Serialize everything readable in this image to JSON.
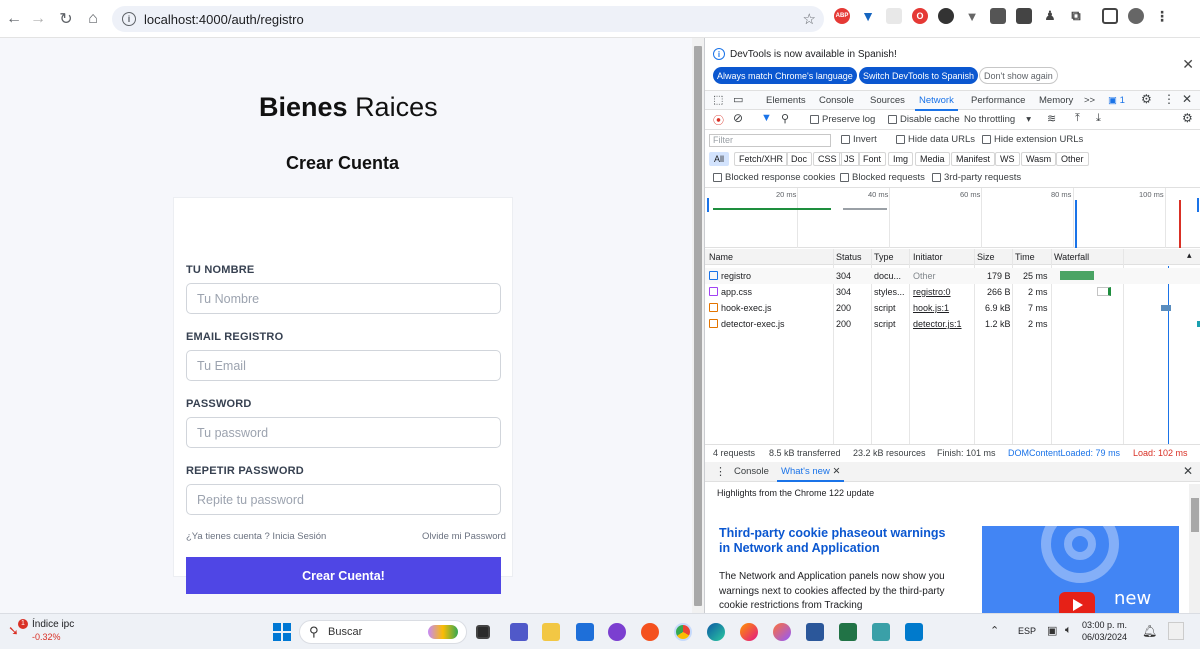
{
  "browser": {
    "url": "localhost:4000/auth/registro"
  },
  "page": {
    "brand_bold": "Bienes",
    "brand_light": "Raices",
    "subtitle": "Crear Cuenta",
    "fields": [
      {
        "label": "TU NOMBRE",
        "placeholder": "Tu Nombre"
      },
      {
        "label": "EMAIL REGISTRO",
        "placeholder": "Tu Email"
      },
      {
        "label": "PASSWORD",
        "placeholder": "Tu password"
      },
      {
        "label": "REPETIR PASSWORD",
        "placeholder": "Repite tu password"
      }
    ],
    "login_link": "¿Ya tienes cuenta ? Inicia Sesión",
    "forgot_link": "Olvide mi Password",
    "submit": "Crear Cuenta!"
  },
  "devtools": {
    "notice": "DevTools is now available in Spanish!",
    "btn_match": "Always match Chrome's language",
    "btn_switch": "Switch DevTools to Spanish",
    "btn_dont": "Don't show again",
    "tabs": [
      "Elements",
      "Console",
      "Sources",
      "Network",
      "Performance",
      "Memory"
    ],
    "more_tabs": ">>",
    "issues_count": "1",
    "preserve_log": "Preserve log",
    "disable_cache": "Disable cache",
    "throttling": "No throttling",
    "filter_placeholder": "Filter",
    "invert": "Invert",
    "hide_data_urls": "Hide data URLs",
    "hide_ext_urls": "Hide extension URLs",
    "type_filters": [
      "All",
      "Fetch/XHR",
      "Doc",
      "CSS",
      "JS",
      "Font",
      "Img",
      "Media",
      "Manifest",
      "WS",
      "Wasm",
      "Other"
    ],
    "blocked_cookies": "Blocked response cookies",
    "blocked_requests": "Blocked requests",
    "third_party": "3rd-party requests",
    "overview_ticks": [
      "20 ms",
      "40 ms",
      "60 ms",
      "80 ms",
      "100 ms"
    ],
    "columns": [
      "Name",
      "Status",
      "Type",
      "Initiator",
      "Size",
      "Time",
      "Waterfall"
    ],
    "rows": [
      {
        "name": "registro",
        "status": "304",
        "type": "docu...",
        "initiator": "Other",
        "size": "179 B",
        "time": "25 ms"
      },
      {
        "name": "app.css",
        "status": "304",
        "type": "styles...",
        "initiator": "registro:0",
        "size": "266 B",
        "time": "2 ms"
      },
      {
        "name": "hook-exec.js",
        "status": "200",
        "type": "script",
        "initiator": "hook.js:1",
        "size": "6.9 kB",
        "time": "7 ms"
      },
      {
        "name": "detector-exec.js",
        "status": "200",
        "type": "script",
        "initiator": "detector.js:1",
        "size": "1.2 kB",
        "time": "2 ms"
      }
    ],
    "summary": {
      "requests": "4 requests",
      "transferred": "8.5 kB transferred",
      "resources": "23.2 kB resources",
      "finish": "Finish: 101 ms",
      "dcl": "DOMContentLoaded: 79 ms",
      "load": "Load: 102 ms"
    },
    "drawer_tabs": [
      "Console",
      "What's new"
    ],
    "highlights": "Highlights from the Chrome 122 update",
    "wn_title": "Third-party cookie phaseout warnings in Network and Application",
    "wn_body": "The Network and Application panels now show you warnings next to cookies affected by the third-party cookie restrictions from Tracking",
    "video_text": "new"
  },
  "taskbar": {
    "widget_title": "Índice ipc",
    "widget_value": "-0.32%",
    "widget_badge": "1",
    "search": "Buscar",
    "lang": "ESP",
    "time": "03:00 p. m.",
    "date": "06/03/2024"
  },
  "colors": {
    "accent": "#4f46e5",
    "devtools_blue": "#1a73e8",
    "load_red": "#d93025"
  }
}
